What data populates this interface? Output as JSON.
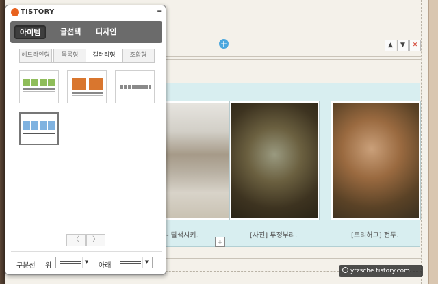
{
  "panel": {
    "logo_text": "TISTORY",
    "minimize_label": "–",
    "main_tabs": [
      {
        "label": "아이템",
        "active": true
      },
      {
        "label": "글선택",
        "active": false
      },
      {
        "label": "디자인",
        "active": false
      }
    ],
    "sub_tabs": [
      {
        "label": "헤드라인형",
        "active": false
      },
      {
        "label": "목록형",
        "active": false
      },
      {
        "label": "갤러리형",
        "active": true
      },
      {
        "label": "조합형",
        "active": false
      }
    ],
    "layout_options": [
      {
        "name": "4-column-green",
        "selected": false
      },
      {
        "name": "2-column-orange",
        "selected": false
      },
      {
        "name": "strip-gray",
        "selected": false
      },
      {
        "name": "4-column-blue",
        "selected": true
      }
    ],
    "pager": {
      "prev": "〈",
      "next": "〉"
    },
    "footer": {
      "divider_label": "구분선",
      "top_label": "위",
      "bottom_label": "아래",
      "arrow": "▼"
    }
  },
  "editor": {
    "insert_label": "+",
    "controls": {
      "up": "▲",
      "down": "▼",
      "close": "✕"
    },
    "gallery": {
      "captions": [
        "- 탈색시키.",
        "[사진] 투정부리.",
        "[프리허그] 전두."
      ],
      "add_label": "+"
    }
  },
  "watermark": "ytzsche.tistory.com",
  "colors": {
    "accent_orange": "#e8621f",
    "gallery_bg": "#d8eef0",
    "insert_blue": "#4aa7de",
    "close_red": "#d23a2a"
  }
}
